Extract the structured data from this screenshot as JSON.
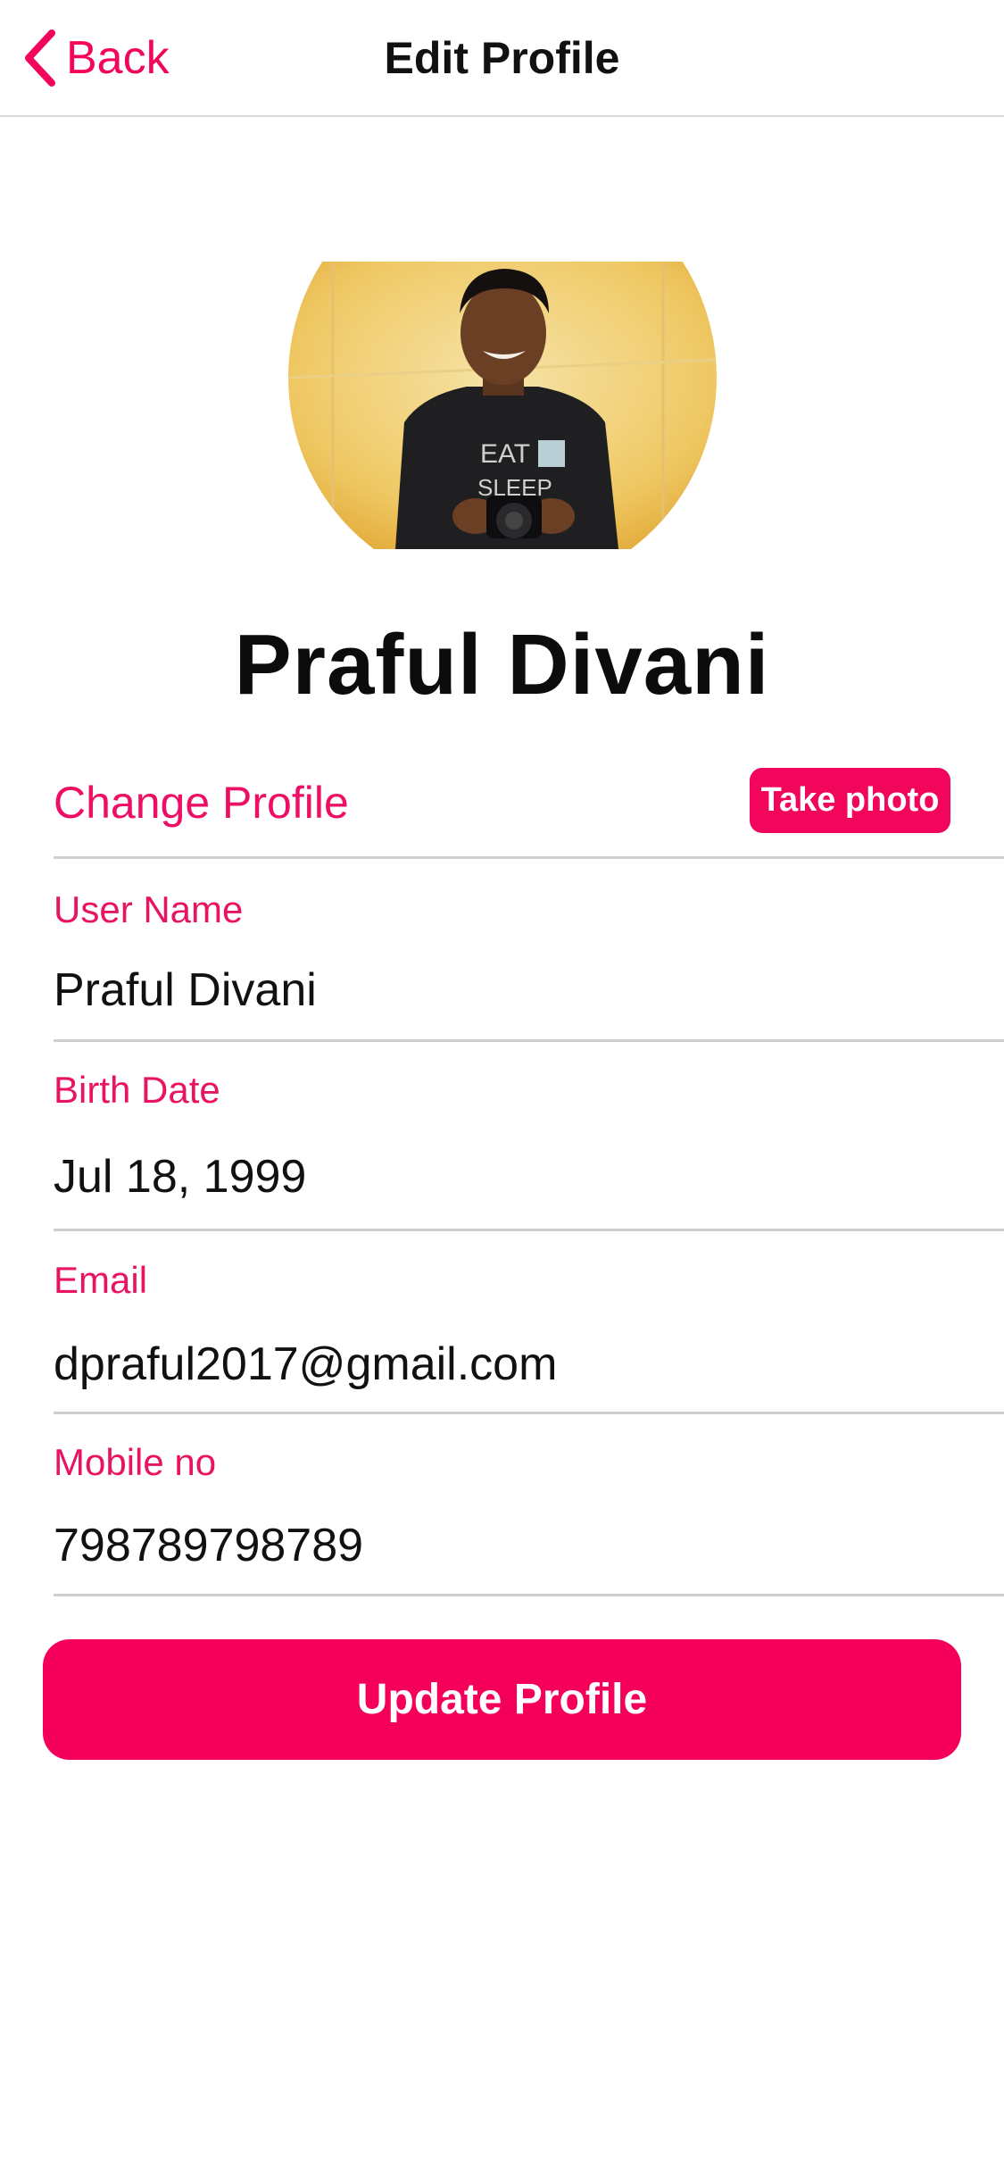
{
  "header": {
    "back_label": "Back",
    "title": "Edit Profile"
  },
  "profile": {
    "name": "Praful Divani"
  },
  "change_profile": {
    "label": "Change Profile",
    "take_photo_label": "Take photo"
  },
  "fields": [
    {
      "label": "User Name",
      "value": "Praful Divani"
    },
    {
      "label": "Birth Date",
      "value": "Jul 18, 1999"
    },
    {
      "label": "Email",
      "value": "dpraful2017@gmail.com"
    },
    {
      "label": "Mobile no",
      "value": "798789798789"
    }
  ],
  "actions": {
    "update_label": "Update Profile"
  },
  "colors": {
    "accent": "#f2065c",
    "divider": "#cfcfcf"
  },
  "icons": {
    "back": "chevron-left-icon"
  }
}
